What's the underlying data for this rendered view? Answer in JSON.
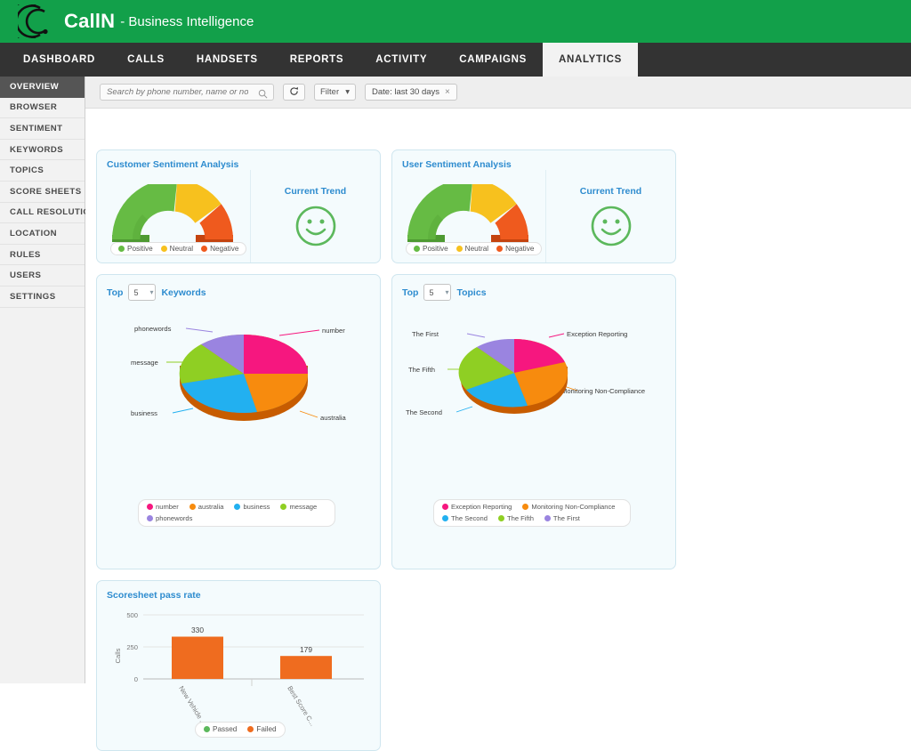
{
  "brand": {
    "logo_icon": "callin-concentric-c-logo",
    "name": "CallN",
    "tagline": "- Business Intelligence",
    "bar_color": "#12a04a"
  },
  "tabs": [
    {
      "label": "DASHBOARD",
      "active": false
    },
    {
      "label": "CALLS",
      "active": false
    },
    {
      "label": "HANDSETS",
      "active": false
    },
    {
      "label": "REPORTS",
      "active": false
    },
    {
      "label": "ACTIVITY",
      "active": false
    },
    {
      "label": "CAMPAIGNS",
      "active": false
    },
    {
      "label": "ANALYTICS",
      "active": true
    }
  ],
  "sidebar": {
    "items": [
      {
        "label": "OVERVIEW",
        "active": true
      },
      {
        "label": "BROWSER",
        "active": false
      },
      {
        "label": "SENTIMENT",
        "active": false
      },
      {
        "label": "KEYWORDS",
        "active": false
      },
      {
        "label": "TOPICS",
        "active": false
      },
      {
        "label": "SCORE SHEETS",
        "active": false
      },
      {
        "label": "CALL RESOLUTION",
        "active": false
      },
      {
        "label": "LOCATION",
        "active": false
      },
      {
        "label": "RULES",
        "active": false
      },
      {
        "label": "USERS",
        "active": false
      },
      {
        "label": "SETTINGS",
        "active": false
      }
    ]
  },
  "toolbar": {
    "search_placeholder": "Search by phone number, name or notes",
    "search_value": "",
    "search_icon": "magnifier-icon",
    "refresh_icon": "refresh-icon",
    "filter_label": "Filter",
    "filter_caret": "▾",
    "date_chip_label": "Date: last 30 days",
    "date_chip_remove": "×"
  },
  "cards": {
    "customer_sentiment": {
      "title": "Customer Sentiment Analysis",
      "trend_title": "Current Trend",
      "trend_icon": "smiley-face-happy-icon",
      "trend_color": "#5cb85c"
    },
    "user_sentiment": {
      "title": "User Sentiment Analysis",
      "trend_title": "Current Trend",
      "trend_icon": "smiley-face-happy-icon",
      "trend_color": "#5cb85c"
    },
    "keywords": {
      "top_label": "Top",
      "count_value": "5",
      "noun_label": "Keywords"
    },
    "topics": {
      "top_label": "Top",
      "count_value": "5",
      "noun_label": "Topics"
    },
    "scoresheet": {
      "title": "Scoresheet pass rate"
    }
  },
  "chart_data": [
    {
      "type": "pie",
      "name": "customer-sentiment-gauge",
      "title": "Customer Sentiment Analysis",
      "variant": "half-donut-gauge",
      "categories": [
        "Positive",
        "Neutral",
        "Negative"
      ],
      "values": [
        55,
        25,
        20
      ],
      "colors": [
        "#66bb44",
        "#f7c11e",
        "#ef5a1e"
      ],
      "legend": [
        "Positive",
        "Neutral",
        "Negative"
      ],
      "legend_position": "bottom"
    },
    {
      "type": "pie",
      "name": "user-sentiment-gauge",
      "title": "User Sentiment Analysis",
      "variant": "half-donut-gauge",
      "categories": [
        "Positive",
        "Neutral",
        "Negative"
      ],
      "values": [
        55,
        25,
        20
      ],
      "colors": [
        "#66bb44",
        "#f7c11e",
        "#ef5a1e"
      ],
      "legend": [
        "Positive",
        "Neutral",
        "Negative"
      ],
      "legend_position": "bottom"
    },
    {
      "type": "pie",
      "name": "top-keywords-pie",
      "title": "Top 5 Keywords",
      "variant": "3d-pie",
      "categories": [
        "number",
        "australia",
        "business",
        "message",
        "phonewords"
      ],
      "values": [
        24,
        24,
        18,
        17,
        17
      ],
      "colors": [
        "#f6177f",
        "#f78b0e",
        "#22b0f0",
        "#8fcf23",
        "#9a84e0"
      ],
      "labels": [
        "number",
        "australia",
        "business",
        "message",
        "phonewords"
      ],
      "legend": [
        "number",
        "australia",
        "business",
        "message",
        "phonewords"
      ],
      "legend_position": "bottom"
    },
    {
      "type": "pie",
      "name": "top-topics-pie",
      "title": "Top 5 Topics",
      "variant": "3d-pie",
      "categories": [
        "Exception Reporting",
        "Monitoring Non-Compliance",
        "The Second",
        "The Fifth",
        "The First"
      ],
      "values": [
        20,
        22,
        19,
        20,
        19
      ],
      "colors": [
        "#f6177f",
        "#f78b0e",
        "#22b0f0",
        "#8fcf23",
        "#9a84e0"
      ],
      "labels": [
        "Exception Reporting",
        "Monitoring Non-Compliance",
        "The Second",
        "The Fifth",
        "The First"
      ],
      "legend": [
        "Exception Reporting",
        "Monitoring Non-Compliance",
        "The Second",
        "The Fifth",
        "The First"
      ],
      "legend_position": "bottom"
    },
    {
      "type": "bar",
      "name": "scoresheet-pass-rate-bar",
      "title": "Scoresheet pass rate",
      "categories": [
        "New Vehicle ...",
        "Best Score C..."
      ],
      "series": [
        {
          "name": "Passed",
          "values": [
            0,
            0
          ],
          "color": "#5cb85c"
        },
        {
          "name": "Failed",
          "values": [
            330,
            179
          ],
          "color": "#ef6c1f"
        }
      ],
      "value_labels": [
        "330",
        "179"
      ],
      "xlabel": "",
      "ylabel": "Calls",
      "ylim": [
        0,
        500
      ],
      "yticks": [
        "0",
        "250",
        "500"
      ],
      "grid": true,
      "legend": [
        "Passed",
        "Failed"
      ],
      "legend_position": "bottom"
    }
  ]
}
